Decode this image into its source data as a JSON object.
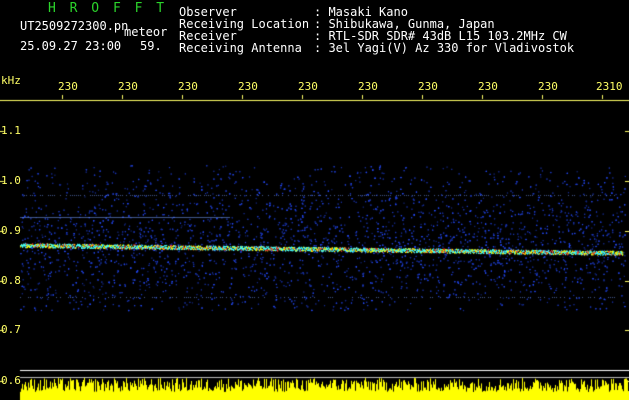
{
  "header": {
    "brand": "H R O F F T",
    "filename": "UT2509272300.pn",
    "mode": "meteor",
    "datetime": "25.09.27 23:00",
    "count": "59.",
    "info_labels": [
      "Observer",
      "Receiving Location",
      "Receiver",
      "Receiving Antenna"
    ],
    "info_values": [
      ": Masaki Kano",
      ": Shibukawa, Gunma, Japan",
      ": RTL-SDR SDR# 43dB L15 103.2MHz CW",
      ": 3el Yagi(V) Az 330 for Vladivostok"
    ]
  },
  "axis": {
    "unit": "kHz",
    "time_ticks": [
      "230",
      "230",
      "230",
      "230",
      "230",
      "230",
      "230",
      "230",
      "230",
      "2310"
    ],
    "freq_ticks": [
      "1.1",
      "1.0",
      "0.9",
      "0.8",
      "0.7",
      "0.6"
    ]
  },
  "colors": {
    "background": "#000000",
    "label_white": "#ffffff",
    "brand_green": "#2bd42b",
    "tick_yellow": "#ffff66",
    "noise_blue": "#1a2cff",
    "signal_cyan": "#3fffff",
    "signal_yellow": "#ffff00",
    "signal_red": "#ff3a2a"
  }
}
